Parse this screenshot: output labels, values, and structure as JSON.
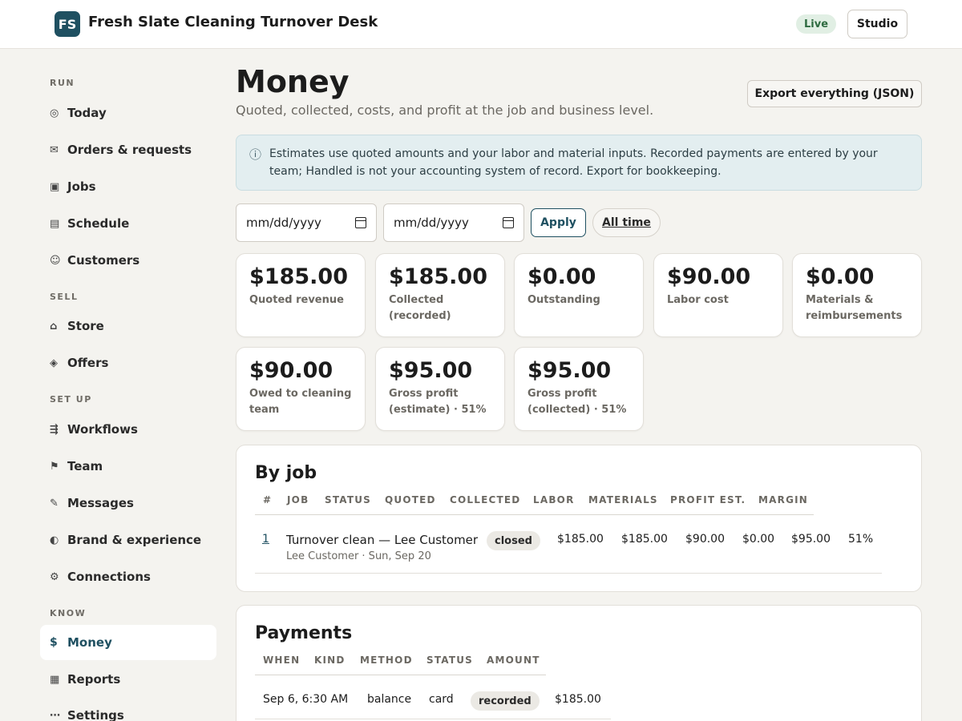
{
  "app": {
    "logo": "FS",
    "title": "Fresh Slate Cleaning Turnover Desk",
    "live_label": "Live",
    "studio_label": "Studio"
  },
  "sidebar": {
    "sections": {
      "run": "RUN",
      "sell": "SELL",
      "setup": "SET UP",
      "know": "KNOW"
    },
    "items": [
      {
        "icon": "◎",
        "label": "Today"
      },
      {
        "icon": "✉",
        "label": "Orders & requests"
      },
      {
        "icon": "▣",
        "label": "Jobs"
      },
      {
        "icon": "▤",
        "label": "Schedule"
      },
      {
        "icon": "☺",
        "label": "Customers"
      },
      {
        "icon": "⌂",
        "label": "Store"
      },
      {
        "icon": "◈",
        "label": "Offers"
      },
      {
        "icon": "⇶",
        "label": "Workflows"
      },
      {
        "icon": "⚑",
        "label": "Team"
      },
      {
        "icon": "✎",
        "label": "Messages"
      },
      {
        "icon": "◐",
        "label": "Brand & experience"
      },
      {
        "icon": "⚙",
        "label": "Connections"
      },
      {
        "icon": "$",
        "label": "Money"
      },
      {
        "icon": "▦",
        "label": "Reports"
      },
      {
        "icon": "⋯",
        "label": "Settings"
      }
    ],
    "active": "Money"
  },
  "header": {
    "title": "Money",
    "subtitle": "Quoted, collected, costs, and profit at the job and business level.",
    "export_label": "Export everything (JSON)"
  },
  "info": {
    "icon": "ⓘ",
    "text": "Estimates use quoted amounts and your labor and material inputs. Recorded payments are entered by your team; Handled is not your accounting system of record. Export for bookkeeping."
  },
  "filters": {
    "from_placeholder": "mm/dd/yyyy",
    "to_placeholder": "mm/dd/yyyy",
    "apply_label": "Apply",
    "alltime_label": "All time"
  },
  "stats": [
    {
      "value": "$185.00",
      "label": "Quoted revenue"
    },
    {
      "value": "$185.00",
      "label": "Collected (recorded)"
    },
    {
      "value": "$0.00",
      "label": "Outstanding"
    },
    {
      "value": "$90.00",
      "label": "Labor cost"
    },
    {
      "value": "$0.00",
      "label": "Materials & reimbursements"
    },
    {
      "value": "$90.00",
      "label": "Owed to cleaning team"
    },
    {
      "value": "$95.00",
      "label": "Gross profit (estimate) · 51%"
    },
    {
      "value": "$95.00",
      "label": "Gross profit (collected) · 51%"
    }
  ],
  "by_job": {
    "title": "By job",
    "headers": [
      "#",
      "JOB",
      "STATUS",
      "QUOTED",
      "COLLECTED",
      "LABOR",
      "MATERIALS",
      "PROFIT EST.",
      "MARGIN"
    ],
    "rows": [
      {
        "num": "1",
        "job": "Turnover clean — Lee Customer",
        "sub": "Lee Customer · Sun, Sep 20",
        "status": "closed",
        "quoted": "$185.00",
        "collected": "$185.00",
        "labor": "$90.00",
        "materials": "$0.00",
        "profit": "$95.00",
        "margin": "51%"
      }
    ]
  },
  "payments": {
    "title": "Payments",
    "headers": [
      "WHEN",
      "KIND",
      "METHOD",
      "STATUS",
      "AMOUNT"
    ],
    "rows": [
      {
        "when": "Sep 6, 6:30 AM",
        "kind": "balance",
        "method": "card",
        "status": "recorded",
        "amount": "$185.00"
      }
    ]
  }
}
